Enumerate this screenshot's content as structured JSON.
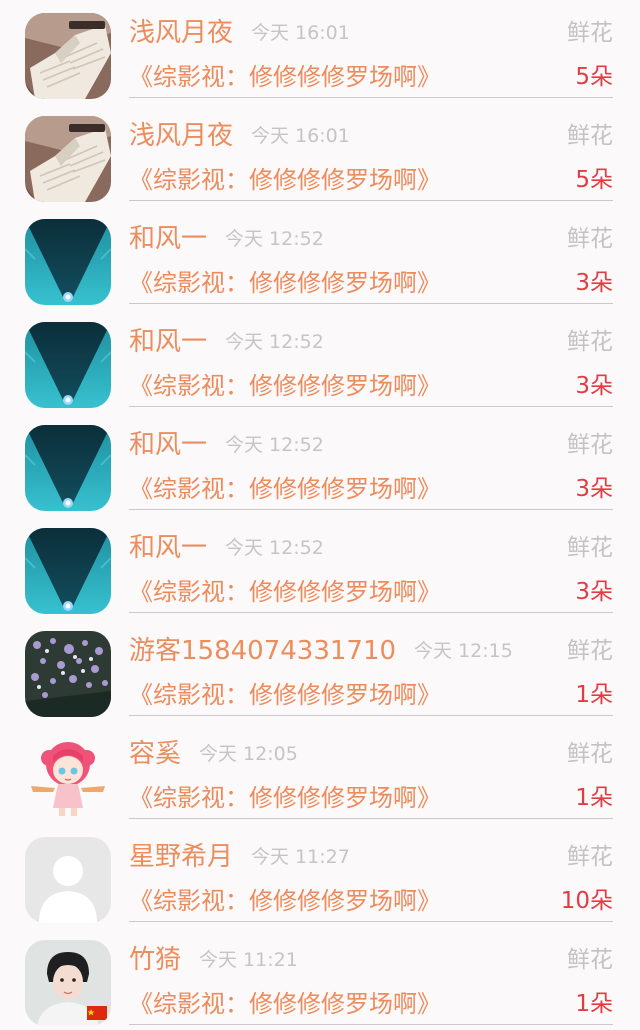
{
  "rows": [
    {
      "name": "浅风月夜",
      "time": "今天 16:01",
      "gift": "鲜花",
      "title": "《综影视：修修修修罗场啊》",
      "count": "5朵",
      "avatar": "book-avatar"
    },
    {
      "name": "浅风月夜",
      "time": "今天 16:01",
      "gift": "鲜花",
      "title": "《综影视：修修修修罗场啊》",
      "count": "5朵",
      "avatar": "book-avatar"
    },
    {
      "name": "和风一",
      "time": "今天 12:52",
      "gift": "鲜花",
      "title": "《综影视：修修修修罗场啊》",
      "count": "3朵",
      "avatar": "teal-light-avatar"
    },
    {
      "name": "和风一",
      "time": "今天 12:52",
      "gift": "鲜花",
      "title": "《综影视：修修修修罗场啊》",
      "count": "3朵",
      "avatar": "teal-light-avatar"
    },
    {
      "name": "和风一",
      "time": "今天 12:52",
      "gift": "鲜花",
      "title": "《综影视：修修修修罗场啊》",
      "count": "3朵",
      "avatar": "teal-light-avatar"
    },
    {
      "name": "和风一",
      "time": "今天 12:52",
      "gift": "鲜花",
      "title": "《综影视：修修修修罗场啊》",
      "count": "3朵",
      "avatar": "teal-light-avatar"
    },
    {
      "name": "游客1584074331710",
      "time": "今天 12:15",
      "gift": "鲜花",
      "title": "《综影视：修修修修罗场啊》",
      "count": "1朵",
      "avatar": "flowers-avatar"
    },
    {
      "name": "容奚",
      "time": "今天 12:05",
      "gift": "鲜花",
      "title": "《综影视：修修修修罗场啊》",
      "count": "1朵",
      "avatar": "anime-girl-avatar"
    },
    {
      "name": "星野希月",
      "time": "今天 11:27",
      "gift": "鲜花",
      "title": "《综影视：修修修修罗场啊》",
      "count": "10朵",
      "avatar": "default-person-avatar"
    },
    {
      "name": "竹猗",
      "time": "今天 11:21",
      "gift": "鲜花",
      "title": "《综影视：修修修修罗场啊》",
      "count": "1朵",
      "avatar": "portrait-avatar"
    }
  ],
  "colors": {
    "name": "#ec8d5e",
    "title": "#ee8b5b",
    "time": "#c7c4c6",
    "gift": "#c5c2c4",
    "count": "#e23c42",
    "divider": "#cbc8ca",
    "background": "#fbf9fa"
  }
}
